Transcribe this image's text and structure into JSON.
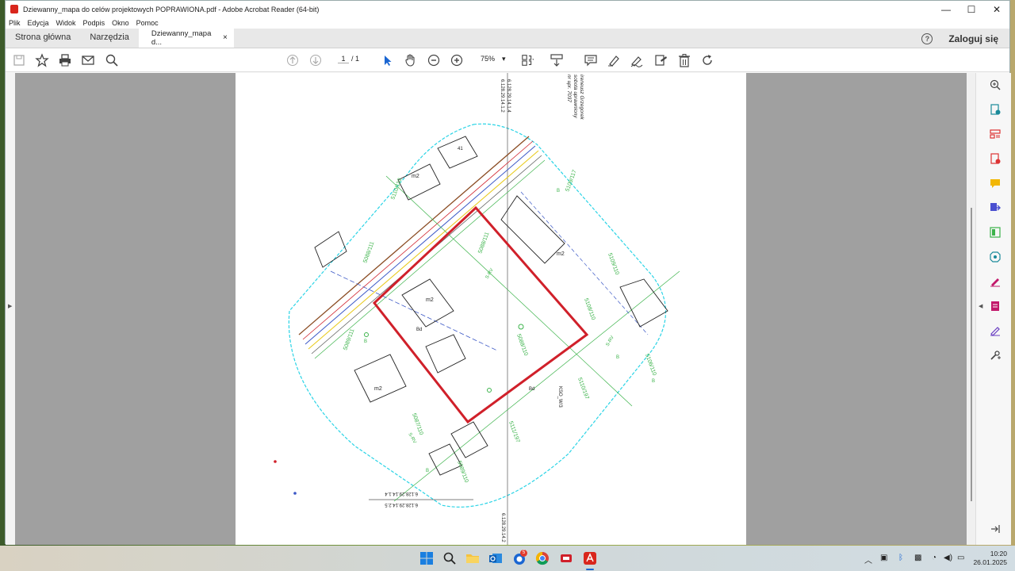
{
  "window": {
    "title": "Dziewanny_mapa do celów projektowych POPRAWIONA.pdf - Adobe Acrobat Reader (64-bit)",
    "controls": {
      "minimize": "—",
      "maximize": "☐",
      "close": "✕"
    }
  },
  "menu": [
    "Plik",
    "Edycja",
    "Widok",
    "Podpis",
    "Okno",
    "Pomoc"
  ],
  "tabs": {
    "home": "Strona główna",
    "tools": "Narzędzia",
    "document": "Dziewanny_mapa d...",
    "close": "×"
  },
  "header_right": {
    "help": "?",
    "signin": "Zaloguj się"
  },
  "toolbar": {
    "page_current": "1",
    "page_total": "/ 1",
    "zoom": "75%",
    "zoom_arrow": "▾"
  },
  "map_texts": {
    "survey_top": "6.128.29.14.1.2",
    "survey_top2": "6.128.29.14.1.4",
    "author": "ireneusz Grzegorek\nsobota uprawniony\nnr upr. 7037",
    "survey_bl1": "6.128.29.14.1.4",
    "survey_bl2": "6.128.29.14.2.5",
    "survey_bottom": "6.128.29.14.2",
    "parcels": [
      "5088/111",
      "5109/110",
      "5109/117",
      "5108/110",
      "5088/110",
      "5106/110",
      "5089/111",
      "5088/111",
      "5110/110",
      "5110/197",
      "5111/197",
      "5087/110",
      "5089/110"
    ],
    "labels_m2": [
      "m2",
      "m2",
      "m2",
      "m2"
    ],
    "labels_B": [
      "B",
      "B",
      "B",
      "B",
      "B"
    ],
    "label_S": [
      "S-RV",
      "S-RV",
      "S-RV"
    ],
    "label_misc": [
      "41",
      "Bd",
      "Bd",
      "KSO_W/3"
    ]
  },
  "colors": {
    "app_red": "#d9261c",
    "boundary_cyan": "#2ad4e6",
    "parcel_red": "#d0202a",
    "parcel_text_green": "#3bb34a",
    "network_blue": "#3a57c6",
    "network_yellow": "#e8c916",
    "network_brown": "#8a4b22"
  },
  "clock": {
    "time": "10:20",
    "date": "26.01.2025"
  },
  "taskbar": {
    "badge_count": "5"
  }
}
